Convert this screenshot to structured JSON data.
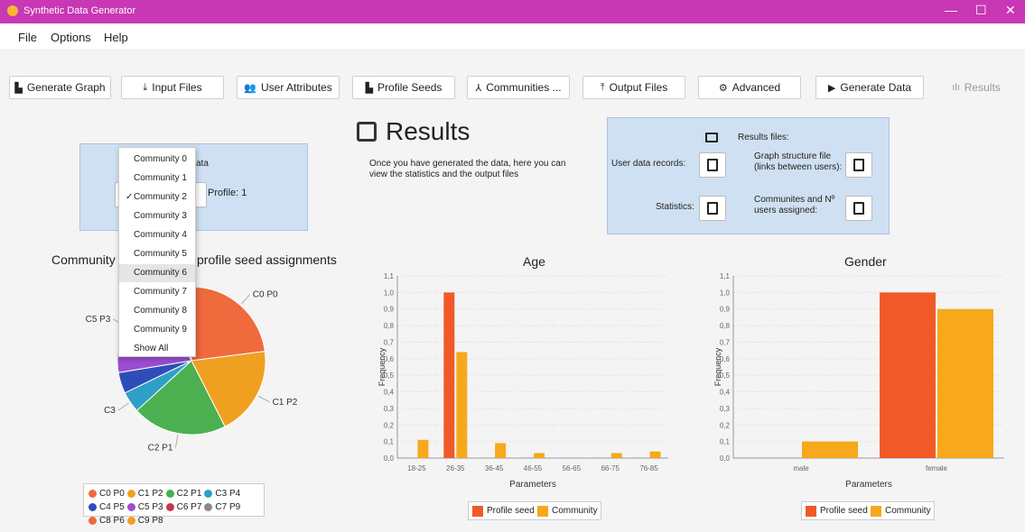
{
  "window": {
    "title": "Synthetic Data Generator",
    "controls": [
      "—",
      "☐",
      "✕"
    ]
  },
  "menu": [
    "File",
    "Options",
    "Help"
  ],
  "toolbar": [
    {
      "label": "Generate Graph",
      "icon": "▙"
    },
    {
      "label": "Input Files",
      "icon": "⤓"
    },
    {
      "label": "User Attributes",
      "icon": "👥"
    },
    {
      "label": "Profile Seeds",
      "icon": "▙"
    },
    {
      "label": "Communities ...",
      "icon": "⅄"
    },
    {
      "label": "Output Files",
      "icon": "⤒"
    },
    {
      "label": "Advanced",
      "icon": "⚙"
    },
    {
      "label": "Generate Data",
      "icon": "▶"
    },
    {
      "label": "Results",
      "icon": "ılı"
    }
  ],
  "left_panel": {
    "title_fragment": "ata",
    "profile_label": "Profile: 1"
  },
  "dropdown": {
    "items": [
      "Community 0",
      "Community 1",
      "Community 2",
      "Community 3",
      "Community 4",
      "Community 5",
      "Community 6",
      "Community 7",
      "Community 8",
      "Community 9",
      "Show All"
    ],
    "checked_index": 2,
    "hover_index": 6
  },
  "results": {
    "title": "Results",
    "description": "Once you have generated the data, here you can view the statistics and the output files"
  },
  "files_panel": {
    "header": "Results files:",
    "user_data": "User data records:",
    "graph_structure": "Graph structure file (links between users):",
    "statistics": "Statistics:",
    "communities": "Communites and Nº users assigned:"
  },
  "pie_title_left": "Community",
  "pie_title_right": "profile seed assignments",
  "colors": {
    "profile_seed": "#f05a28",
    "community": "#f7a81b"
  },
  "chart_data": [
    {
      "type": "pie",
      "title": "Community profile seed assignments",
      "slices": [
        {
          "label": "C0 P0",
          "value": 20,
          "color": "#ef6a3c"
        },
        {
          "label": "C1 P2",
          "value": 17,
          "color": "#f0a020"
        },
        {
          "label": "C2 P1",
          "value": 18,
          "color": "#4caf50"
        },
        {
          "label": "C3 P4",
          "value": 4,
          "color": "#2ea0c8"
        },
        {
          "label": "C4 P5",
          "value": 4,
          "color": "#2f4db8"
        },
        {
          "label": "C5 P3",
          "value": 18,
          "color": "#9b4dd2"
        },
        {
          "label": "C6 P7",
          "value": 2,
          "color": "#c0394a"
        },
        {
          "label": "C7 P9",
          "value": 1,
          "color": "#8a8a8a"
        },
        {
          "label": "C8 P6",
          "value": 2,
          "color": "#ef6a3c"
        },
        {
          "label": "C9 P8",
          "value": 1,
          "color": "#f0a020"
        }
      ],
      "visible_labels": [
        "C5 P3",
        "C6 P7",
        "C8 P6",
        "C0 P0",
        "C1 P2",
        "C2 P1",
        "C3"
      ],
      "legend": [
        "C0 P0",
        "C1 P2",
        "C2 P1",
        "C3 P4",
        "C4 P5",
        "C5 P3",
        "C6 P7",
        "C7 P9",
        "C8 P6",
        "C9 P8"
      ]
    },
    {
      "type": "bar",
      "title": "Age",
      "xlabel": "Parameters",
      "ylabel": "Frequency",
      "ylim": [
        0,
        1.1
      ],
      "yticks": [
        "0,0",
        "0,1",
        "0,2",
        "0,3",
        "0,4",
        "0,5",
        "0,6",
        "0,7",
        "0,8",
        "0,9",
        "1,0",
        "1,1"
      ],
      "categories": [
        "18-25",
        "26-35",
        "36-45",
        "46-55",
        "56-65",
        "66-75",
        "76-85"
      ],
      "series": [
        {
          "name": "Profile seed",
          "values": [
            0,
            1.0,
            0,
            0,
            0,
            0,
            0
          ]
        },
        {
          "name": "Community",
          "values": [
            0.11,
            0.64,
            0.09,
            0.03,
            0,
            0.03,
            0.04
          ]
        }
      ]
    },
    {
      "type": "bar",
      "title": "Gender",
      "xlabel": "Parameters",
      "ylabel": "Frequency",
      "ylim": [
        0,
        1.1
      ],
      "yticks": [
        "0,0",
        "0,1",
        "0,2",
        "0,3",
        "0,4",
        "0,5",
        "0,6",
        "0,7",
        "0,8",
        "0,9",
        "1,0",
        "1,1"
      ],
      "categories": [
        "male",
        "female"
      ],
      "series": [
        {
          "name": "Profile seed",
          "values": [
            0,
            1.0
          ]
        },
        {
          "name": "Community",
          "values": [
            0.1,
            0.9
          ]
        }
      ]
    }
  ]
}
